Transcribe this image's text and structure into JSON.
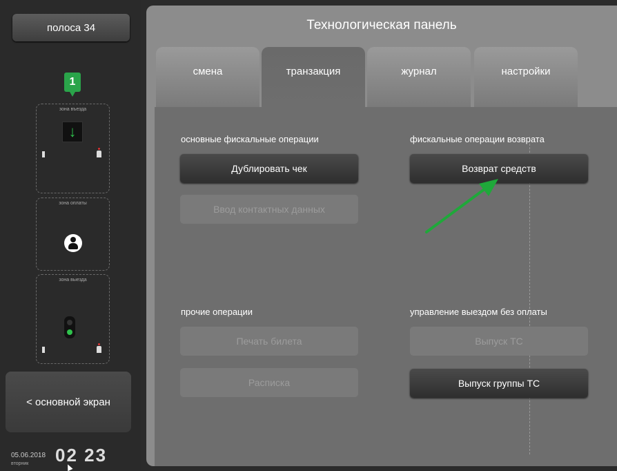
{
  "sidebar": {
    "lane_label": "полоса 34",
    "badge": "1",
    "zones": [
      {
        "label": "зона въезда",
        "icon": "arrow-down-icon"
      },
      {
        "label": "зона оплаты",
        "icon": "person-icon"
      },
      {
        "label": "зона выезда",
        "icon": "traffic-light-icon"
      }
    ],
    "home_button": "< основной экран",
    "date": "05.06.2018",
    "weekday": "вторник",
    "time": "02 23"
  },
  "panel": {
    "title": "Технологическая панель",
    "tabs": [
      {
        "label": "смена",
        "active": false
      },
      {
        "label": "транзакция",
        "active": true
      },
      {
        "label": "журнал",
        "active": false
      },
      {
        "label": "настройки",
        "active": false
      }
    ],
    "sections": {
      "main_fiscal": {
        "title": "основные фискальные операции",
        "buttons": [
          {
            "label": "Дублировать чек",
            "enabled": true
          },
          {
            "label": "Ввод контактных данных",
            "enabled": false
          }
        ]
      },
      "refund_fiscal": {
        "title": "фискальные операции возврата",
        "buttons": [
          {
            "label": "Возврат средств",
            "enabled": true
          }
        ]
      },
      "other": {
        "title": "прочие операции",
        "buttons": [
          {
            "label": "Печать билета",
            "enabled": false
          },
          {
            "label": "Расписка",
            "enabled": false
          }
        ]
      },
      "exit_control": {
        "title": "управление выездом без оплаты",
        "buttons": [
          {
            "label": "Выпуск ТС",
            "enabled": false
          },
          {
            "label": "Выпуск группы ТС",
            "enabled": true
          }
        ]
      }
    }
  },
  "colors": {
    "accent_green": "#2aa44a",
    "arrow_green": "#1fa83a"
  }
}
